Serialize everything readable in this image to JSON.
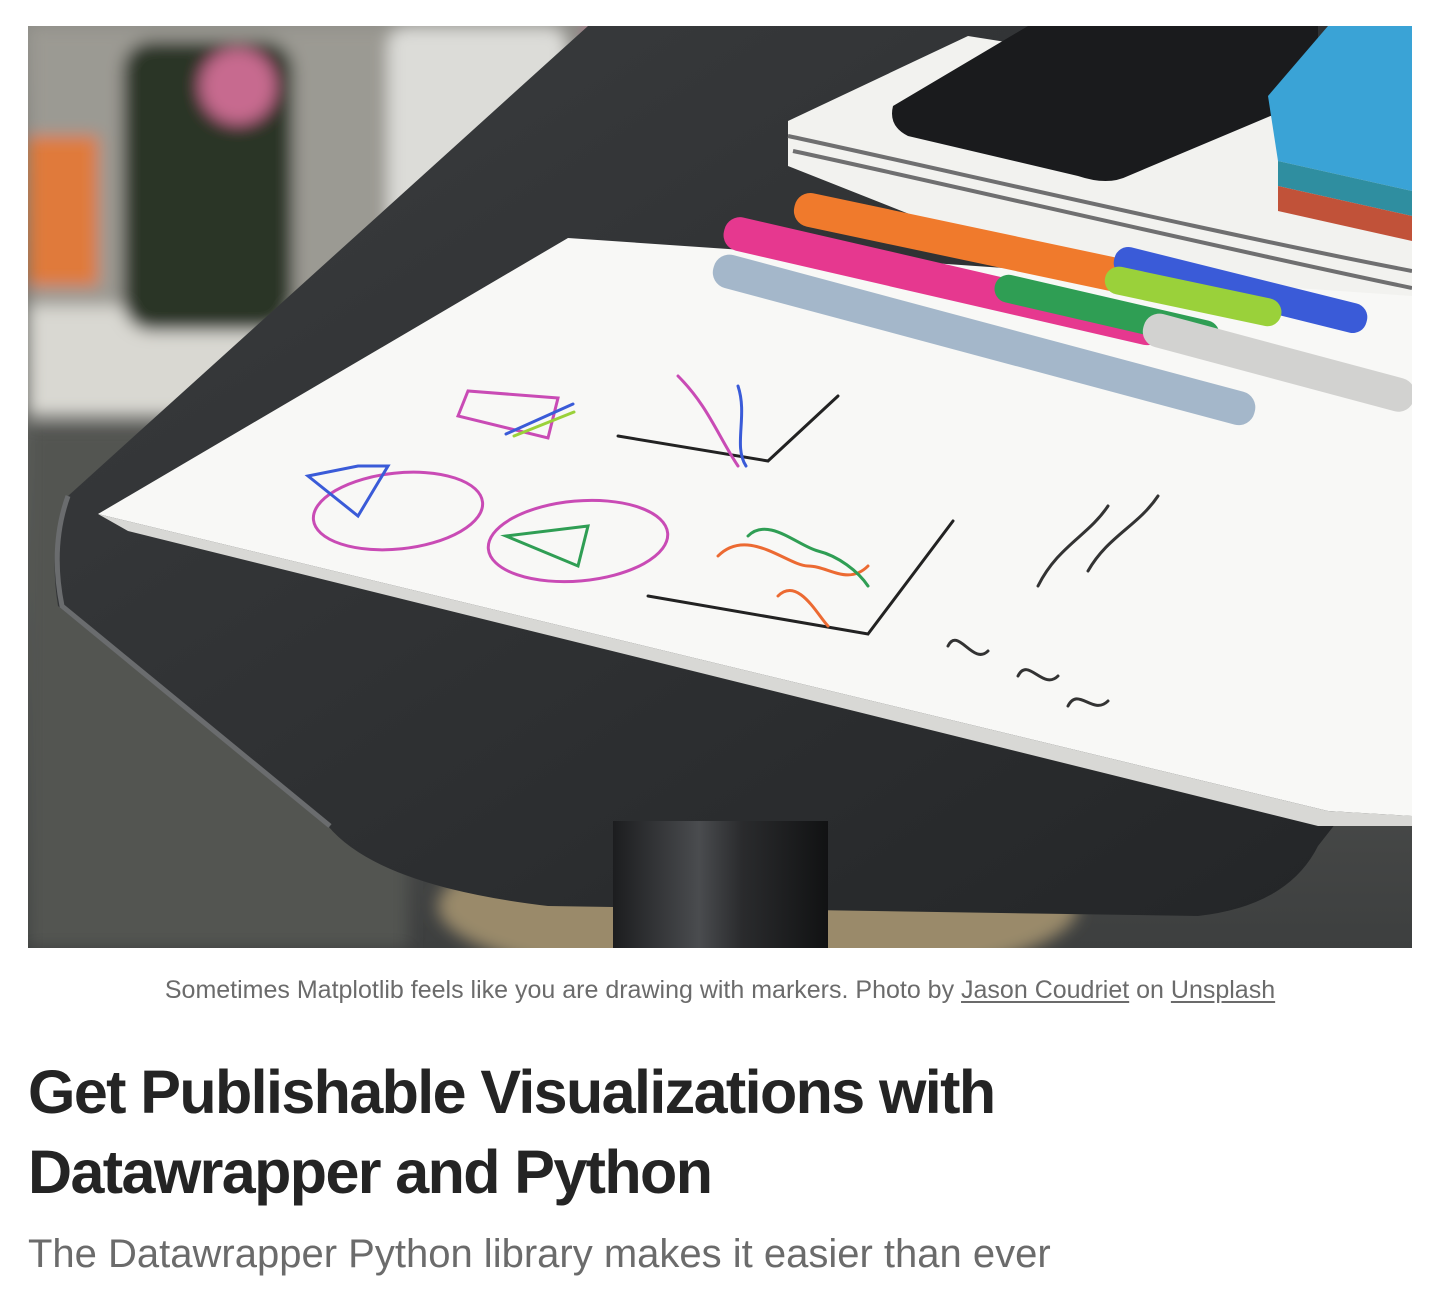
{
  "hero_image": {
    "description_icon": "photo-of-hand-drawn-charts-with-markers"
  },
  "caption": {
    "text": "Sometimes Matplotlib feels like you are drawing with markers. Photo by ",
    "author_link": "Jason Coudriet",
    "connector": " on ",
    "source_link": "Unsplash"
  },
  "article": {
    "title": "Get Publishable Visualizations with Datawrapper and Python",
    "subtitle": "The Datawrapper Python library makes it easier than ever"
  },
  "colors": {
    "title": "#242424",
    "muted_text": "#6b6b6b",
    "background": "#ffffff"
  }
}
